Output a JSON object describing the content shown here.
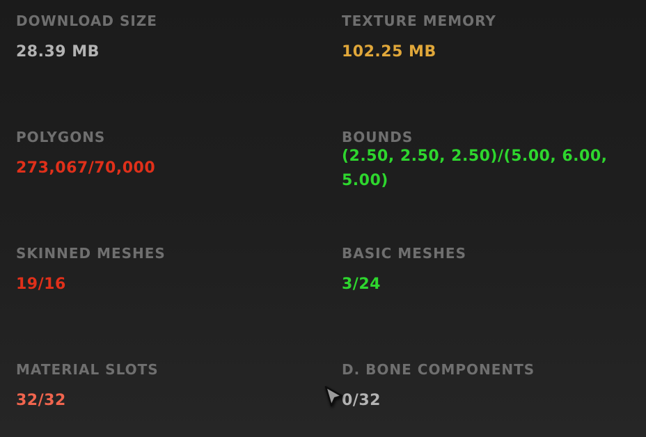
{
  "stats": [
    {
      "id": "download-size",
      "label": "DOWNLOAD SIZE",
      "value": "28.39 MB",
      "color": "#b3b3b3"
    },
    {
      "id": "texture-memory",
      "label": "TEXTURE MEMORY",
      "value": "102.25 MB",
      "color": "#e0a73a"
    },
    {
      "id": "polygons",
      "label": "POLYGONS",
      "value": "273,067/70,000",
      "color": "#e0301a"
    },
    {
      "id": "bounds",
      "label": "BOUNDS",
      "value": "(2.50, 2.50, 2.50)/(5.00, 6.00, 5.00)",
      "color": "#2ed62e"
    },
    {
      "id": "skinned-meshes",
      "label": "SKINNED MESHES",
      "value": "19/16",
      "color": "#e0301a"
    },
    {
      "id": "basic-meshes",
      "label": "BASIC MESHES",
      "value": "3/24",
      "color": "#2ed62e"
    },
    {
      "id": "material-slots",
      "label": "MATERIAL SLOTS",
      "value": "32/32",
      "color": "#f0654e"
    },
    {
      "id": "d-bone-components",
      "label": "D. BONE COMPONENTS",
      "value": "0/32",
      "color": "#b3b3b3"
    }
  ],
  "cursor": {
    "icon": "mouse-pointer-icon"
  }
}
